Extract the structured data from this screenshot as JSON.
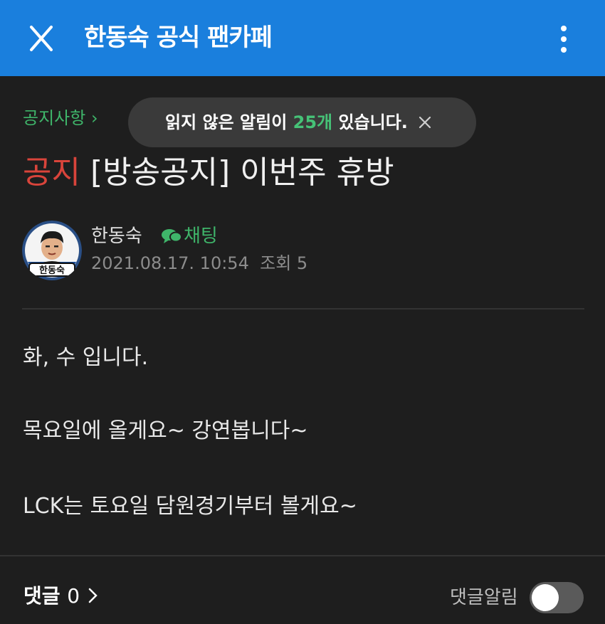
{
  "header": {
    "title": "한동숙 공식 팬카페",
    "close_icon": "close-icon",
    "more_icon": "more-vertical-icon",
    "bg_color": "#1a7fdd"
  },
  "category": {
    "label": "공지사항 ›"
  },
  "toast": {
    "prefix": "읽지 않은 알림이 ",
    "count": "25개",
    "suffix": " 있습니다.",
    "close_icon": "close-icon"
  },
  "post": {
    "tag": "공지",
    "title": "[방송공지] 이번주 휴방",
    "author": "한동숙",
    "avatar_label": "한동숙",
    "chat_label": "채팅",
    "date": "2021.08.17. 10:54",
    "views": "조회 5",
    "body": [
      "화, 수 입니다.",
      "목요일에 올게요~ 강연봅니다~",
      "LCK는 토요일 담원경기부터 볼게요~"
    ]
  },
  "footer": {
    "comments_label": "댓글",
    "comments_count": "0",
    "notify_label": "댓글알림",
    "notify_on": false
  },
  "colors": {
    "accent_green": "#3fb56a",
    "notice_red": "#d9443b",
    "background": "#1e1e1e"
  }
}
